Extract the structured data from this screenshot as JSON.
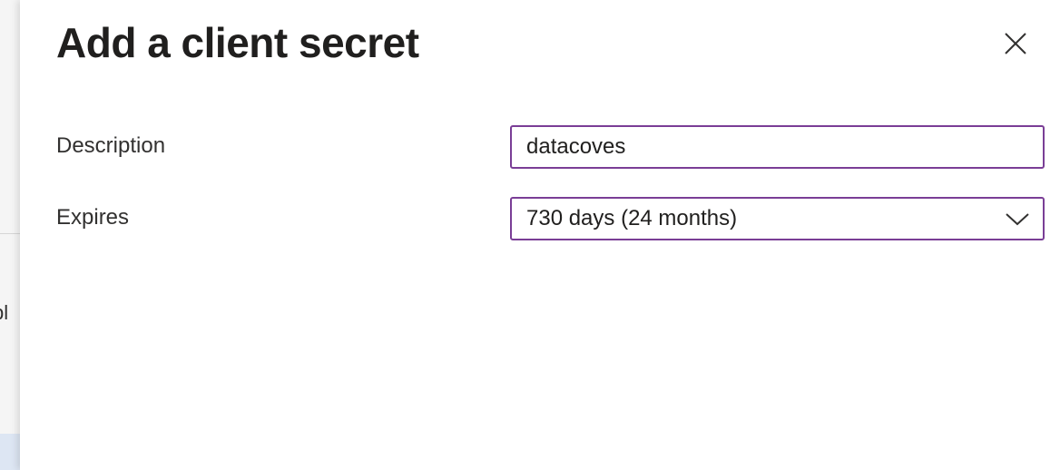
{
  "background": {
    "partial_text": "bl"
  },
  "panel": {
    "title": "Add a client secret",
    "close_icon": "close-icon"
  },
  "form": {
    "description": {
      "label": "Description",
      "value": "datacoves"
    },
    "expires": {
      "label": "Expires",
      "selected": "730 days (24 months)",
      "icon": "chevron-down-icon"
    }
  },
  "colors": {
    "input_border": "#7a3e96",
    "title_text": "#201f1e",
    "label_text": "#323130",
    "panel_bg": "#ffffff",
    "backdrop_bg": "#f5f5f5"
  }
}
